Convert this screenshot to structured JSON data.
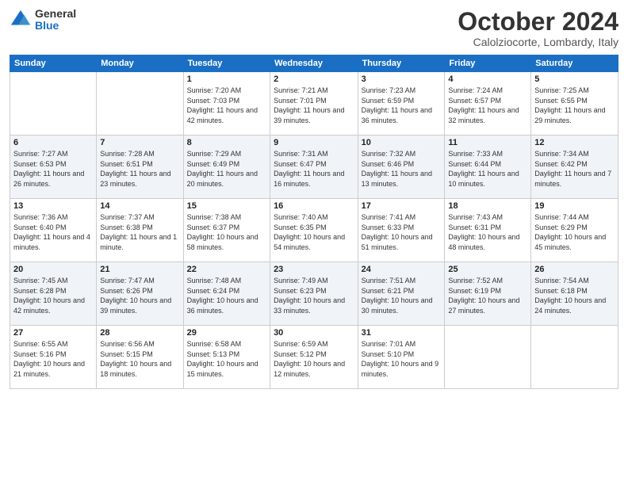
{
  "logo": {
    "general": "General",
    "blue": "Blue"
  },
  "header": {
    "month": "October 2024",
    "location": "Calolziocorte, Lombardy, Italy"
  },
  "weekdays": [
    "Sunday",
    "Monday",
    "Tuesday",
    "Wednesday",
    "Thursday",
    "Friday",
    "Saturday"
  ],
  "weeks": [
    [
      null,
      null,
      {
        "day": 1,
        "sunrise": "7:20 AM",
        "sunset": "7:03 PM",
        "daylight": "11 hours and 42 minutes."
      },
      {
        "day": 2,
        "sunrise": "7:21 AM",
        "sunset": "7:01 PM",
        "daylight": "11 hours and 39 minutes."
      },
      {
        "day": 3,
        "sunrise": "7:23 AM",
        "sunset": "6:59 PM",
        "daylight": "11 hours and 36 minutes."
      },
      {
        "day": 4,
        "sunrise": "7:24 AM",
        "sunset": "6:57 PM",
        "daylight": "11 hours and 32 minutes."
      },
      {
        "day": 5,
        "sunrise": "7:25 AM",
        "sunset": "6:55 PM",
        "daylight": "11 hours and 29 minutes."
      }
    ],
    [
      {
        "day": 6,
        "sunrise": "7:27 AM",
        "sunset": "6:53 PM",
        "daylight": "11 hours and 26 minutes."
      },
      {
        "day": 7,
        "sunrise": "7:28 AM",
        "sunset": "6:51 PM",
        "daylight": "11 hours and 23 minutes."
      },
      {
        "day": 8,
        "sunrise": "7:29 AM",
        "sunset": "6:49 PM",
        "daylight": "11 hours and 20 minutes."
      },
      {
        "day": 9,
        "sunrise": "7:31 AM",
        "sunset": "6:47 PM",
        "daylight": "11 hours and 16 minutes."
      },
      {
        "day": 10,
        "sunrise": "7:32 AM",
        "sunset": "6:46 PM",
        "daylight": "11 hours and 13 minutes."
      },
      {
        "day": 11,
        "sunrise": "7:33 AM",
        "sunset": "6:44 PM",
        "daylight": "11 hours and 10 minutes."
      },
      {
        "day": 12,
        "sunrise": "7:34 AM",
        "sunset": "6:42 PM",
        "daylight": "11 hours and 7 minutes."
      }
    ],
    [
      {
        "day": 13,
        "sunrise": "7:36 AM",
        "sunset": "6:40 PM",
        "daylight": "11 hours and 4 minutes."
      },
      {
        "day": 14,
        "sunrise": "7:37 AM",
        "sunset": "6:38 PM",
        "daylight": "11 hours and 1 minute."
      },
      {
        "day": 15,
        "sunrise": "7:38 AM",
        "sunset": "6:37 PM",
        "daylight": "10 hours and 58 minutes."
      },
      {
        "day": 16,
        "sunrise": "7:40 AM",
        "sunset": "6:35 PM",
        "daylight": "10 hours and 54 minutes."
      },
      {
        "day": 17,
        "sunrise": "7:41 AM",
        "sunset": "6:33 PM",
        "daylight": "10 hours and 51 minutes."
      },
      {
        "day": 18,
        "sunrise": "7:43 AM",
        "sunset": "6:31 PM",
        "daylight": "10 hours and 48 minutes."
      },
      {
        "day": 19,
        "sunrise": "7:44 AM",
        "sunset": "6:29 PM",
        "daylight": "10 hours and 45 minutes."
      }
    ],
    [
      {
        "day": 20,
        "sunrise": "7:45 AM",
        "sunset": "6:28 PM",
        "daylight": "10 hours and 42 minutes."
      },
      {
        "day": 21,
        "sunrise": "7:47 AM",
        "sunset": "6:26 PM",
        "daylight": "10 hours and 39 minutes."
      },
      {
        "day": 22,
        "sunrise": "7:48 AM",
        "sunset": "6:24 PM",
        "daylight": "10 hours and 36 minutes."
      },
      {
        "day": 23,
        "sunrise": "7:49 AM",
        "sunset": "6:23 PM",
        "daylight": "10 hours and 33 minutes."
      },
      {
        "day": 24,
        "sunrise": "7:51 AM",
        "sunset": "6:21 PM",
        "daylight": "10 hours and 30 minutes."
      },
      {
        "day": 25,
        "sunrise": "7:52 AM",
        "sunset": "6:19 PM",
        "daylight": "10 hours and 27 minutes."
      },
      {
        "day": 26,
        "sunrise": "7:54 AM",
        "sunset": "6:18 PM",
        "daylight": "10 hours and 24 minutes."
      }
    ],
    [
      {
        "day": 27,
        "sunrise": "6:55 AM",
        "sunset": "5:16 PM",
        "daylight": "10 hours and 21 minutes."
      },
      {
        "day": 28,
        "sunrise": "6:56 AM",
        "sunset": "5:15 PM",
        "daylight": "10 hours and 18 minutes."
      },
      {
        "day": 29,
        "sunrise": "6:58 AM",
        "sunset": "5:13 PM",
        "daylight": "10 hours and 15 minutes."
      },
      {
        "day": 30,
        "sunrise": "6:59 AM",
        "sunset": "5:12 PM",
        "daylight": "10 hours and 12 minutes."
      },
      {
        "day": 31,
        "sunrise": "7:01 AM",
        "sunset": "5:10 PM",
        "daylight": "10 hours and 9 minutes."
      },
      null,
      null
    ]
  ]
}
